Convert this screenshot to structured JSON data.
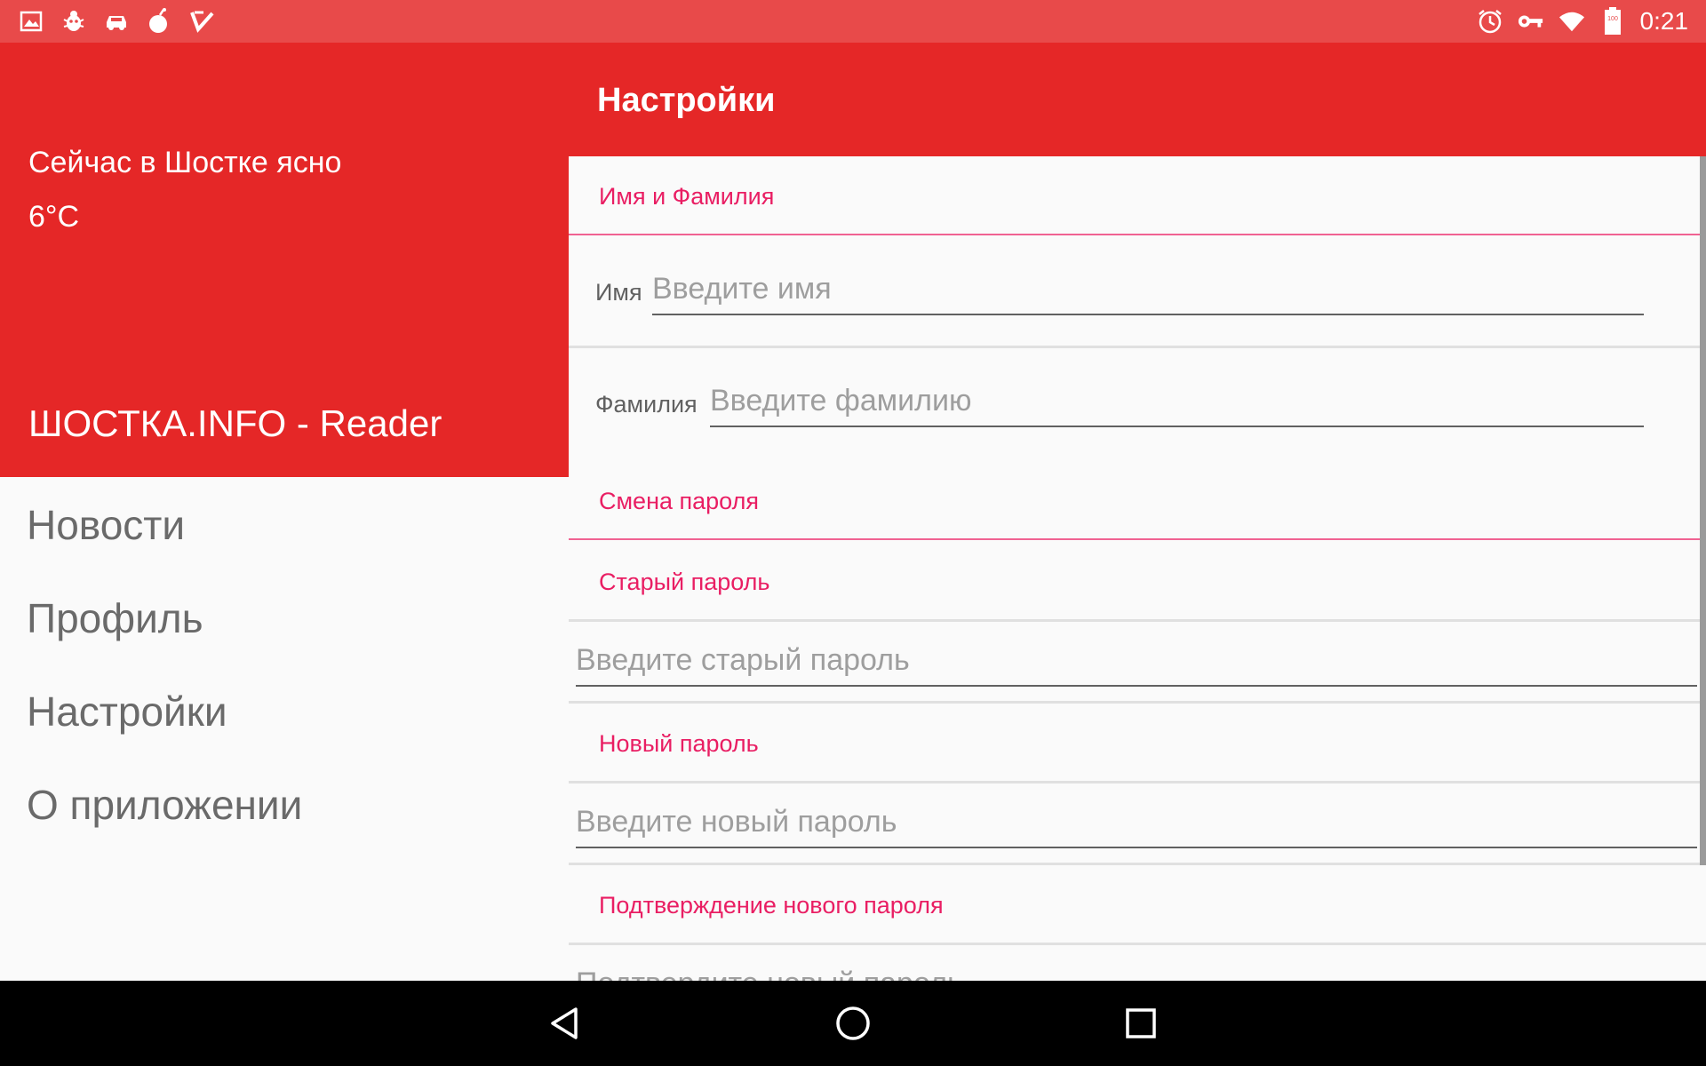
{
  "status_bar": {
    "left_icons": [
      "image-icon",
      "bug-icon",
      "car-icon",
      "bomb-icon",
      "check-icon"
    ],
    "right_icons": [
      "alarm-icon",
      "key-icon",
      "wifi-icon",
      "battery-icon"
    ],
    "battery_level": "100",
    "time": "0:21",
    "color": "#e84a4a"
  },
  "drawer": {
    "weather_line1": "Сейчас в Шостке ясно",
    "weather_line2": "6°C",
    "app_name": "ШОСТКА.INFO - Reader",
    "items": [
      {
        "label": "Новости"
      },
      {
        "label": "Профиль"
      },
      {
        "label": "Настройки"
      },
      {
        "label": "О приложении"
      }
    ]
  },
  "toolbar": {
    "title": "Настройки",
    "color": "#e52727"
  },
  "settings": {
    "accent_color": "#e91e63",
    "name_category": "Имя и Фамилия",
    "first_name_label": "Имя",
    "first_name_placeholder": "Введите имя",
    "last_name_label": "Фамилия",
    "last_name_placeholder": "Введите фамилию",
    "password_category": "Смена пароля",
    "old_password_title": "Старый пароль",
    "old_password_placeholder": "Введите старый пароль",
    "new_password_title": "Новый пароль",
    "new_password_placeholder": "Введите новый пароль",
    "confirm_password_title": "Подтверждение нового пароля",
    "confirm_password_placeholder": "Подтвердите новый пароль"
  },
  "navigation_bar": {
    "buttons": [
      "back-icon",
      "home-icon",
      "recents-icon"
    ]
  }
}
